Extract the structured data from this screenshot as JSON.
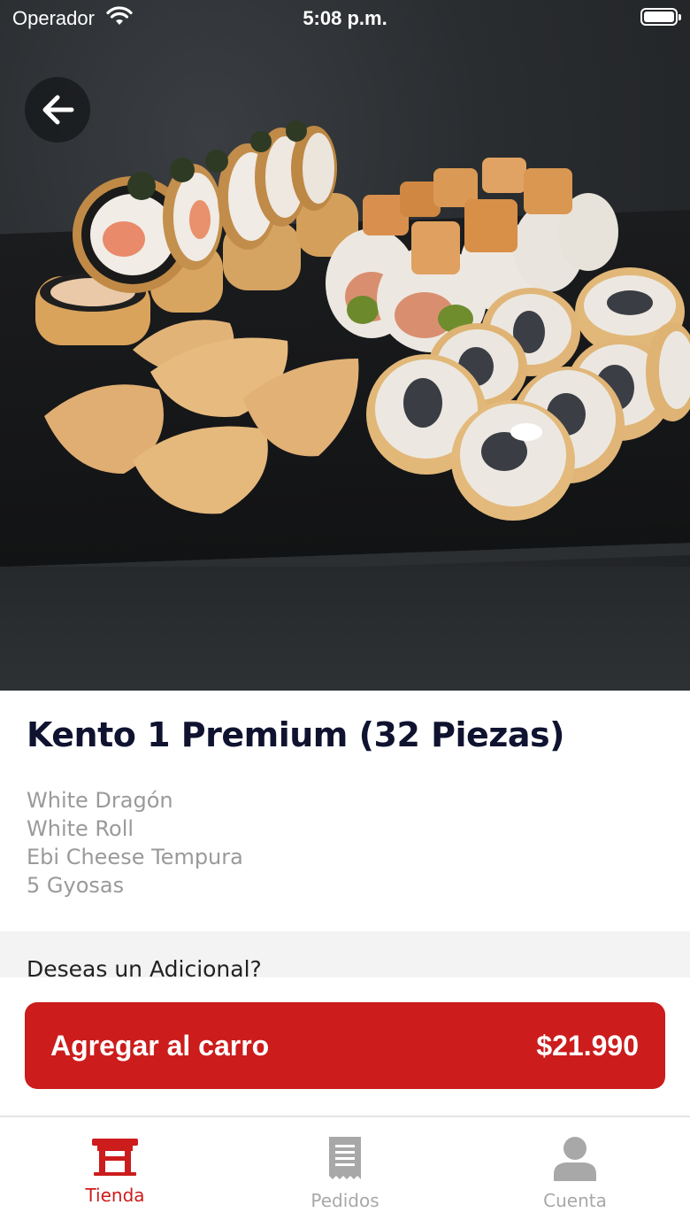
{
  "status_bar": {
    "carrier": "Operador",
    "time": "5:08 p.m."
  },
  "hero": {
    "image": "sushi-platter-photo"
  },
  "product": {
    "title": "Kento 1 Premium (32 Piezas)",
    "description": [
      "White Dragón",
      "White Roll",
      "Ebi Cheese Tempura",
      "5 Gyosas"
    ]
  },
  "extras": {
    "question": "Deseas un Adicional?"
  },
  "cta": {
    "label": "Agregar al carro",
    "price": "$21.990"
  },
  "tabbar": {
    "tabs": [
      {
        "label": "Tienda",
        "icon": "store-icon",
        "active": true
      },
      {
        "label": "Pedidos",
        "icon": "receipt-icon",
        "active": false
      },
      {
        "label": "Cuenta",
        "icon": "user-icon",
        "active": false
      }
    ]
  },
  "colors": {
    "accent": "#cc1c1c",
    "title": "#0f1330",
    "muted": "#9a9a9a"
  }
}
